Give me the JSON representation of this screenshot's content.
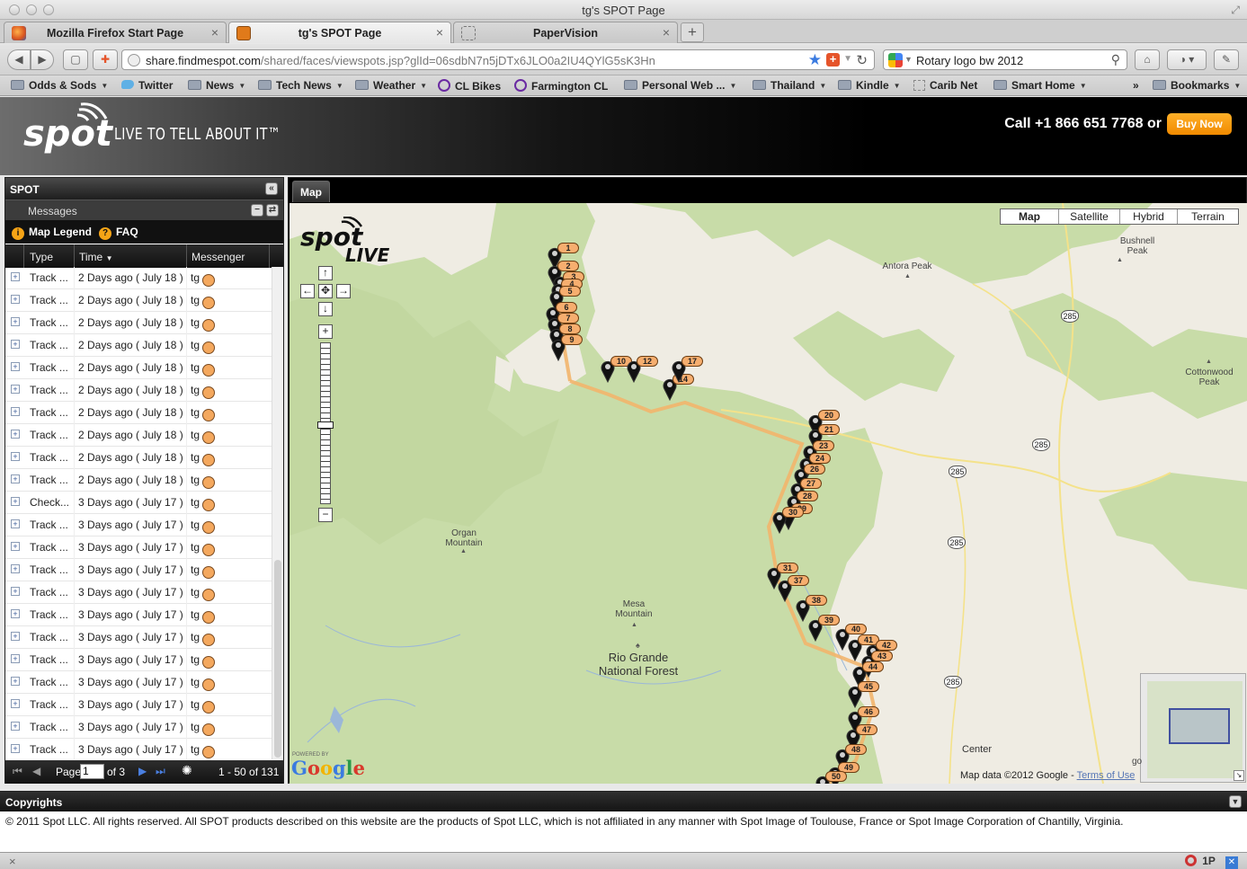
{
  "window": {
    "title": "tg's SPOT Page"
  },
  "tabs": [
    {
      "label": "Mozilla Firefox Start Page"
    },
    {
      "label": "tg's SPOT Page"
    },
    {
      "label": "PaperVision"
    }
  ],
  "navbar": {
    "url_host": "share.findmespot.com",
    "url_path": "/shared/faces/viewspots.jsp?glId=06sdbN7n5jDTx6JLO0a2IU4QYlG5sK3Hn",
    "search_query": "Rotary logo bw 2012"
  },
  "bookmarks": [
    {
      "label": "Odds & Sods",
      "kind": "folder"
    },
    {
      "label": "Twitter",
      "kind": "bird"
    },
    {
      "label": "News",
      "kind": "folder"
    },
    {
      "label": "Tech News",
      "kind": "folder"
    },
    {
      "label": "Weather",
      "kind": "folder"
    },
    {
      "label": "CL Bikes",
      "kind": "peace"
    },
    {
      "label": "Farmington CL",
      "kind": "peace"
    },
    {
      "label": "Personal Web ...",
      "kind": "folder"
    },
    {
      "label": "Thailand",
      "kind": "folder"
    },
    {
      "label": "Kindle",
      "kind": "folder"
    },
    {
      "label": "Carib Net",
      "kind": "dotted"
    },
    {
      "label": "Smart Home",
      "kind": "folder"
    },
    {
      "label": "Bookmarks",
      "kind": "folder"
    }
  ],
  "header": {
    "tagline": "LIVE TO TELL ABOUT IT™",
    "call": "Call +1 866 651 7768 or",
    "buy": "Buy Now",
    "logo_text": "spot"
  },
  "left_panel": {
    "title": "SPOT",
    "messages_label": "Messages",
    "legend_label": "Map Legend",
    "faq_label": "FAQ",
    "columns": {
      "type": "Type",
      "time": "Time",
      "messenger": "Messenger"
    },
    "rows": [
      {
        "type": "Track ...",
        "time": "2 Days ago ( July 18 )",
        "messenger": "tg"
      },
      {
        "type": "Track ...",
        "time": "2 Days ago ( July 18 )",
        "messenger": "tg"
      },
      {
        "type": "Track ...",
        "time": "2 Days ago ( July 18 )",
        "messenger": "tg"
      },
      {
        "type": "Track ...",
        "time": "2 Days ago ( July 18 )",
        "messenger": "tg"
      },
      {
        "type": "Track ...",
        "time": "2 Days ago ( July 18 )",
        "messenger": "tg"
      },
      {
        "type": "Track ...",
        "time": "2 Days ago ( July 18 )",
        "messenger": "tg"
      },
      {
        "type": "Track ...",
        "time": "2 Days ago ( July 18 )",
        "messenger": "tg"
      },
      {
        "type": "Track ...",
        "time": "2 Days ago ( July 18 )",
        "messenger": "tg"
      },
      {
        "type": "Track ...",
        "time": "2 Days ago ( July 18 )",
        "messenger": "tg"
      },
      {
        "type": "Track ...",
        "time": "2 Days ago ( July 18 )",
        "messenger": "tg"
      },
      {
        "type": "Check...",
        "time": "3 Days ago ( July 17 )",
        "messenger": "tg"
      },
      {
        "type": "Track ...",
        "time": "3 Days ago ( July 17 )",
        "messenger": "tg"
      },
      {
        "type": "Track ...",
        "time": "3 Days ago ( July 17 )",
        "messenger": "tg"
      },
      {
        "type": "Track ...",
        "time": "3 Days ago ( July 17 )",
        "messenger": "tg"
      },
      {
        "type": "Track ...",
        "time": "3 Days ago ( July 17 )",
        "messenger": "tg"
      },
      {
        "type": "Track ...",
        "time": "3 Days ago ( July 17 )",
        "messenger": "tg"
      },
      {
        "type": "Track ...",
        "time": "3 Days ago ( July 17 )",
        "messenger": "tg"
      },
      {
        "type": "Track ...",
        "time": "3 Days ago ( July 17 )",
        "messenger": "tg"
      },
      {
        "type": "Track ...",
        "time": "3 Days ago ( July 17 )",
        "messenger": "tg"
      },
      {
        "type": "Track ...",
        "time": "3 Days ago ( July 17 )",
        "messenger": "tg"
      },
      {
        "type": "Track ...",
        "time": "3 Days ago ( July 17 )",
        "messenger": "tg"
      },
      {
        "type": "Track ...",
        "time": "3 Days ago ( July 17 )",
        "messenger": "tg"
      }
    ],
    "footer": {
      "page_label": "Page",
      "page_value": "1",
      "of_label": "of 3",
      "range": "1 - 50 of 131"
    }
  },
  "map": {
    "tab": "Map",
    "types": [
      "Map",
      "Satellite",
      "Hybrid",
      "Terrain"
    ],
    "labels": [
      "Bushnell Peak",
      "Antora Peak",
      "Cottonwood Peak",
      "Organ Mountain",
      "Mesa Mountain",
      "Rio Grande National Forest",
      "Center"
    ],
    "shields": [
      "285",
      "285",
      "285",
      "285",
      "285"
    ],
    "markers": [
      "1",
      "2",
      "3",
      "4",
      "5",
      "6",
      "7",
      "8",
      "9",
      "10",
      "12",
      "14",
      "17",
      "20",
      "21",
      "23",
      "24",
      "26",
      "27",
      "28",
      "29",
      "30",
      "31",
      "37",
      "38",
      "39",
      "40",
      "41",
      "42",
      "43",
      "44",
      "45",
      "46",
      "47",
      "48",
      "49",
      "50"
    ],
    "attribution": "Map data ©2012 Google",
    "terms": "Terms of Use",
    "powered_by": "POWERED BY",
    "google": "Google",
    "go_text": "go"
  },
  "copyrights": {
    "title": "Copyrights",
    "text": "© 2011 Spot LLC. All rights reserved. All SPOT products described on this website are the products of Spot LLC, which is not affiliated in any manner with Spot Image of Toulouse, France or Spot Image Corporation of Chantilly, Virginia."
  },
  "statusbar": {
    "right": "1P"
  },
  "colors": {
    "accent_orange": "#f6a416",
    "track_line": "#f2b56b",
    "forest_green": "#c8dca8"
  }
}
